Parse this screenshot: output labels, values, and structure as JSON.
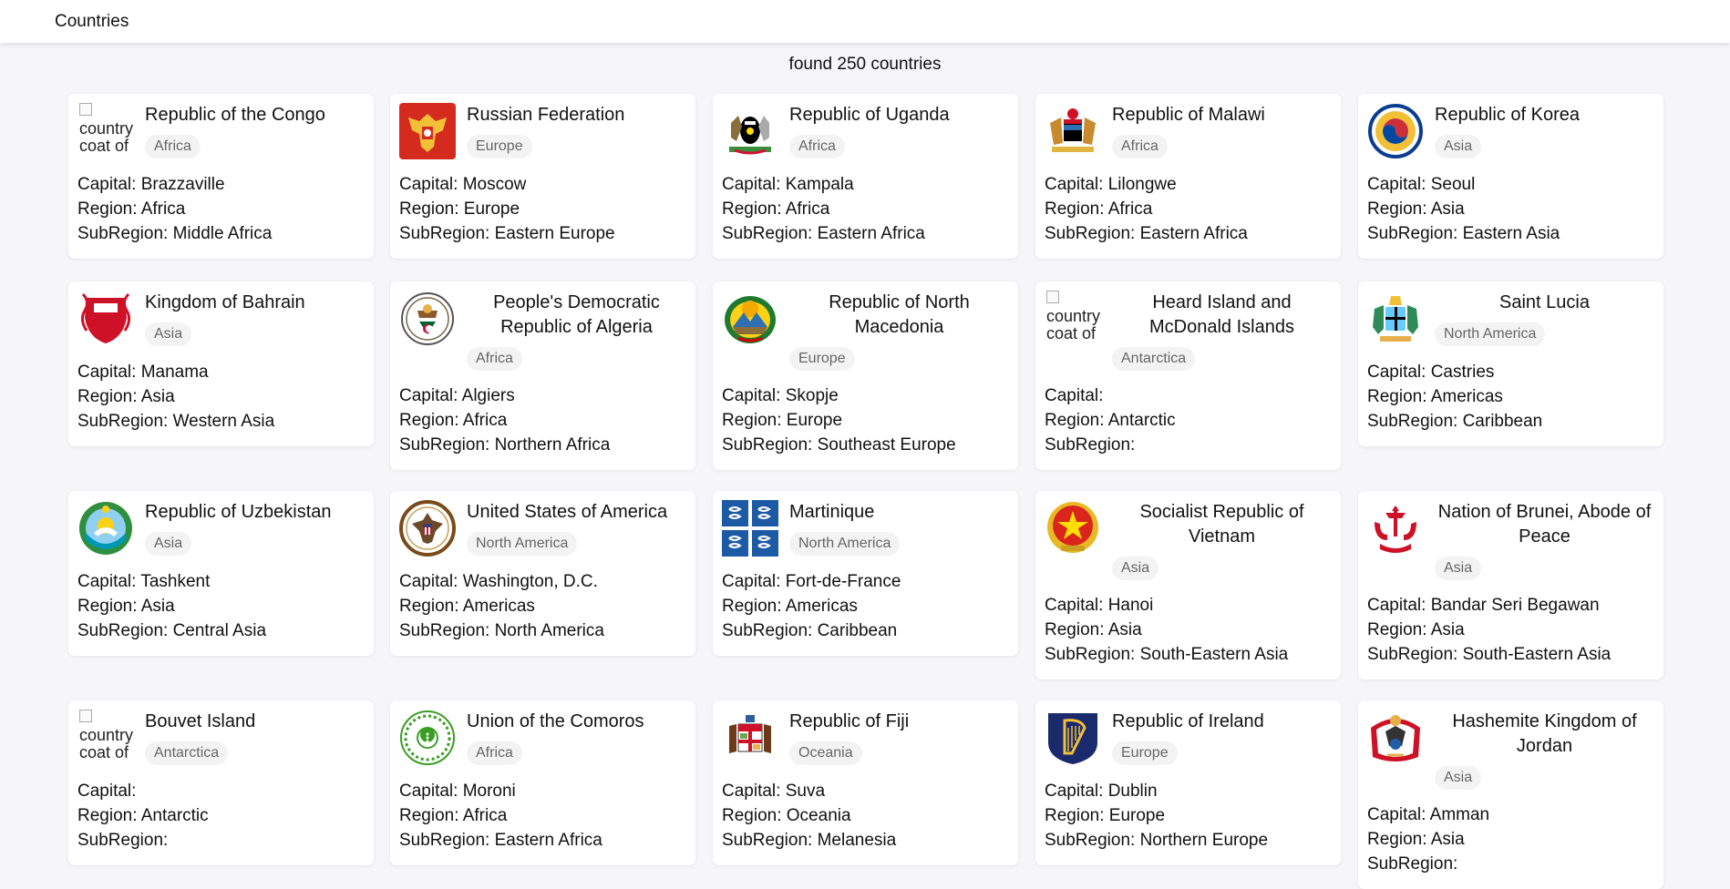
{
  "header": {
    "brand": "Countries"
  },
  "summary": "found 250 countries",
  "labels": {
    "capital": "Capital:",
    "region": "Region:",
    "subregion": "SubRegion:"
  },
  "broken_image_alt": "country coat of arms",
  "countries": [
    {
      "name": "Republic of the Congo",
      "badge": "Africa",
      "capital": "Brazzaville",
      "region": "Africa",
      "subregion": "Middle Africa",
      "emblem": "broken-image"
    },
    {
      "name": "Russian Federation",
      "badge": "Europe",
      "capital": "Moscow",
      "region": "Europe",
      "subregion": "Eastern Europe",
      "emblem": "russia-eagle-icon"
    },
    {
      "name": "Republic of Uganda",
      "badge": "Africa",
      "capital": "Kampala",
      "region": "Africa",
      "subregion": "Eastern Africa",
      "emblem": "uganda-arms-icon"
    },
    {
      "name": "Republic of Malawi",
      "badge": "Africa",
      "capital": "Lilongwe",
      "region": "Africa",
      "subregion": "Eastern Africa",
      "emblem": "malawi-arms-icon"
    },
    {
      "name": "Republic of Korea",
      "badge": "Asia",
      "capital": "Seoul",
      "region": "Asia",
      "subregion": "Eastern Asia",
      "emblem": "korea-seal-icon"
    },
    {
      "name": "Kingdom of Bahrain",
      "badge": "Asia",
      "capital": "Manama",
      "region": "Asia",
      "subregion": "Western Asia",
      "emblem": "bahrain-arms-icon"
    },
    {
      "name": "People's Democratic Republic of Algeria",
      "badge": "Africa",
      "capital": "Algiers",
      "region": "Africa",
      "subregion": "Northern Africa",
      "emblem": "algeria-seal-icon"
    },
    {
      "name": "Republic of North Macedonia",
      "badge": "Europe",
      "capital": "Skopje",
      "region": "Europe",
      "subregion": "Southeast Europe",
      "emblem": "macedonia-arms-icon"
    },
    {
      "name": "Heard Island and McDonald Islands",
      "badge": "Antarctica",
      "capital": "",
      "region": "Antarctic",
      "subregion": "",
      "emblem": "broken-image"
    },
    {
      "name": "Saint Lucia",
      "badge": "North America",
      "capital": "Castries",
      "region": "Americas",
      "subregion": "Caribbean",
      "emblem": "saint-lucia-arms-icon"
    },
    {
      "name": "Republic of Uzbekistan",
      "badge": "Asia",
      "capital": "Tashkent",
      "region": "Asia",
      "subregion": "Central Asia",
      "emblem": "uzbekistan-emblem-icon"
    },
    {
      "name": "United States of America",
      "badge": "North America",
      "capital": "Washington, D.C.",
      "region": "Americas",
      "subregion": "North America",
      "emblem": "usa-seal-icon"
    },
    {
      "name": "Martinique",
      "badge": "North America",
      "capital": "Fort-de-France",
      "region": "Americas",
      "subregion": "Caribbean",
      "emblem": "martinique-flag-icon"
    },
    {
      "name": "Socialist Republic of Vietnam",
      "badge": "Asia",
      "capital": "Hanoi",
      "region": "Asia",
      "subregion": "South-Eastern Asia",
      "emblem": "vietnam-emblem-icon"
    },
    {
      "name": "Nation of Brunei, Abode of Peace",
      "badge": "Asia",
      "capital": "Bandar Seri Begawan",
      "region": "Asia",
      "subregion": "South-Eastern Asia",
      "emblem": "brunei-emblem-icon"
    },
    {
      "name": "Bouvet Island",
      "badge": "Antarctica",
      "capital": "",
      "region": "Antarctic",
      "subregion": "",
      "emblem": "broken-image"
    },
    {
      "name": "Union of the Comoros",
      "badge": "Africa",
      "capital": "Moroni",
      "region": "Africa",
      "subregion": "Eastern Africa",
      "emblem": "comoros-seal-icon"
    },
    {
      "name": "Republic of Fiji",
      "badge": "Oceania",
      "capital": "Suva",
      "region": "Oceania",
      "subregion": "Melanesia",
      "emblem": "fiji-arms-icon"
    },
    {
      "name": "Republic of Ireland",
      "badge": "Europe",
      "capital": "Dublin",
      "region": "Europe",
      "subregion": "Northern Europe",
      "emblem": "ireland-harp-icon"
    },
    {
      "name": "Hashemite Kingdom of Jordan",
      "badge": "Asia",
      "capital": "Amman",
      "region": "Asia",
      "subregion": "",
      "emblem": "jordan-arms-icon"
    }
  ]
}
